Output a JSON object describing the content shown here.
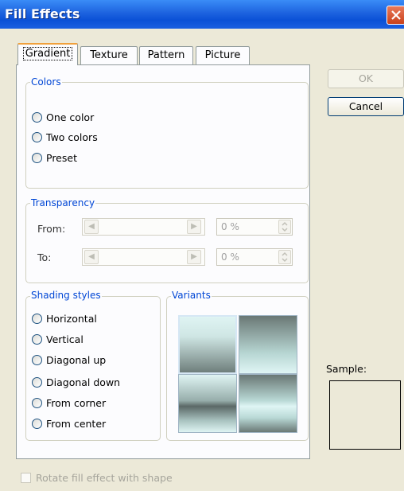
{
  "window": {
    "title": "Fill Effects"
  },
  "tabs": [
    {
      "label": "Gradient"
    },
    {
      "label": "Texture"
    },
    {
      "label": "Pattern"
    },
    {
      "label": "Picture"
    }
  ],
  "colors": {
    "legend": "Colors",
    "options": [
      {
        "label": "One color"
      },
      {
        "label": "Two colors"
      },
      {
        "label": "Preset"
      }
    ]
  },
  "transparency": {
    "legend": "Transparency",
    "from": {
      "label": "From:",
      "value": "0 %"
    },
    "to": {
      "label": "To:",
      "value": "0 %"
    }
  },
  "shading": {
    "legend": "Shading styles",
    "options": [
      {
        "label": "Horizontal"
      },
      {
        "label": "Vertical"
      },
      {
        "label": "Diagonal up"
      },
      {
        "label": "Diagonal down"
      },
      {
        "label": "From corner"
      },
      {
        "label": "From center"
      }
    ]
  },
  "variants": {
    "legend": "Variants"
  },
  "buttons": {
    "ok": "OK",
    "cancel": "Cancel"
  },
  "sample": {
    "label": "Sample:"
  },
  "rotate": {
    "label": "Rotate fill effect with shape"
  },
  "theme": {
    "accent": "#0046d5",
    "titlebar": "#0a50d6",
    "dialog_bg": "#ece9d8"
  }
}
